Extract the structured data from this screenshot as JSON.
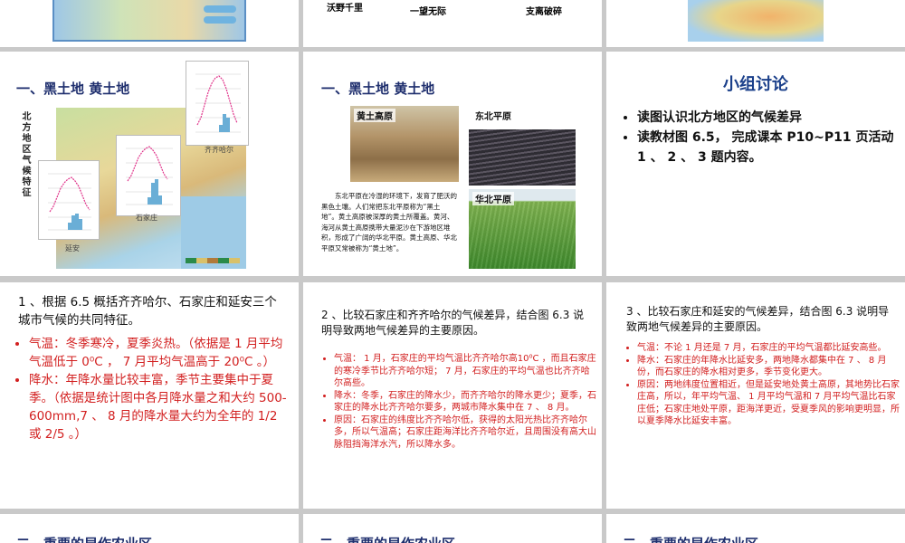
{
  "row_top": {
    "left_caption": "",
    "mid_caption_1": "沃野千里",
    "mid_caption_2": "一望无际",
    "mid_caption_3": "支离破碎"
  },
  "slide_a": {
    "title": "一、黑土地 黄土地",
    "side_label": "北方地区气候特征",
    "city_qiqihar": "齐齐哈尔",
    "city_shijiazhuang": "石家庄",
    "city_yanan": "延安"
  },
  "slide_b": {
    "title": "一、黑土地 黄土地",
    "photo1": "黄土高原",
    "photo2": "东北平原",
    "photo3": "华北平原",
    "paragraph": "东北平原在冷湿的环境下，发育了肥沃的黑色土壤。人们常把东北平原称为“黑土地”。黄土高原被深厚的黄土所覆盖。黄河、海河从黄土高原携带大量泥沙在下游地区堆积，形成了广阔的华北平原。黄土高原、华北平原又常被称为“黄土地”。"
  },
  "slide_c": {
    "title": "小组讨论",
    "bullets": [
      "读图认识北方地区的气候差异",
      "读教材图 6.5， 完成课本 P10~P11 页活动 1 、 2 、 3 题内容。"
    ]
  },
  "slide_d": {
    "question": "1 、根据 6.5 概括齐齐哈尔、石家庄和延安三个城市气候的共同特征。",
    "answers": [
      "气温：冬季寒冷，夏季炎热。（依据是 1 月平均气温低于 0⁰C ， 7 月平均气温高于 20⁰C 。）",
      "降水：年降水量比较丰富，季节主要集中于夏季。（依据是统计图中各月降水量之和大约 500-600mm,7 、 8 月的降水量大约为全年的 1/2 或 2/5 。）"
    ]
  },
  "slide_e": {
    "question": "2 、比较石家庄和齐齐哈尔的气候差异，结合图 6.3 说明导致两地气候差异的主要原因。",
    "answers": [
      "气温： 1 月，石家庄的平均气温比齐齐哈尔高10⁰C ，而且石家庄的寒冷季节比齐齐哈尔短； 7 月，石家庄的平均气温也比齐齐哈尔高些。",
      "降水：冬季，石家庄的降水少，而齐齐哈尔的降水更少；夏季，石家庄的降水比齐齐哈尔要多，两城市降水集中在 7 、 8 月。",
      "原因：石家庄的纬度比齐齐哈尔低，获得的太阳光热比齐齐哈尔多，所以气温高；石家庄距海洋比齐齐哈尔近，且周围没有高大山脉阻挡海洋水汽，所以降水多。"
    ]
  },
  "slide_f": {
    "question": "3 、比较石家庄和延安的气候差异，结合图 6.3 说明导致两地气候差异的主要原因。",
    "answers": [
      "气温：不论 1 月还是 7 月，石家庄的平均气温都比延安高些。",
      "降水：石家庄的年降水比延安多，两地降水都集中在 7 、 8 月份，而石家庄的降水相对更多，季节变化更大。",
      "原因：两地纬度位置相近，但是延安地处黄土高原，其地势比石家庄高，所以，年平均气温、 1 月平均气温和 7 月平均气温比石家庄低；石家庄地处平原，距海洋更近，受夏季风的影响更明显，所以夏季降水比延安丰富。"
    ]
  },
  "row_bottom": {
    "title1": "二、重要的早作农业区",
    "title2": "二、重要的早作农业区",
    "title3": "二、重要的早作农业区"
  }
}
